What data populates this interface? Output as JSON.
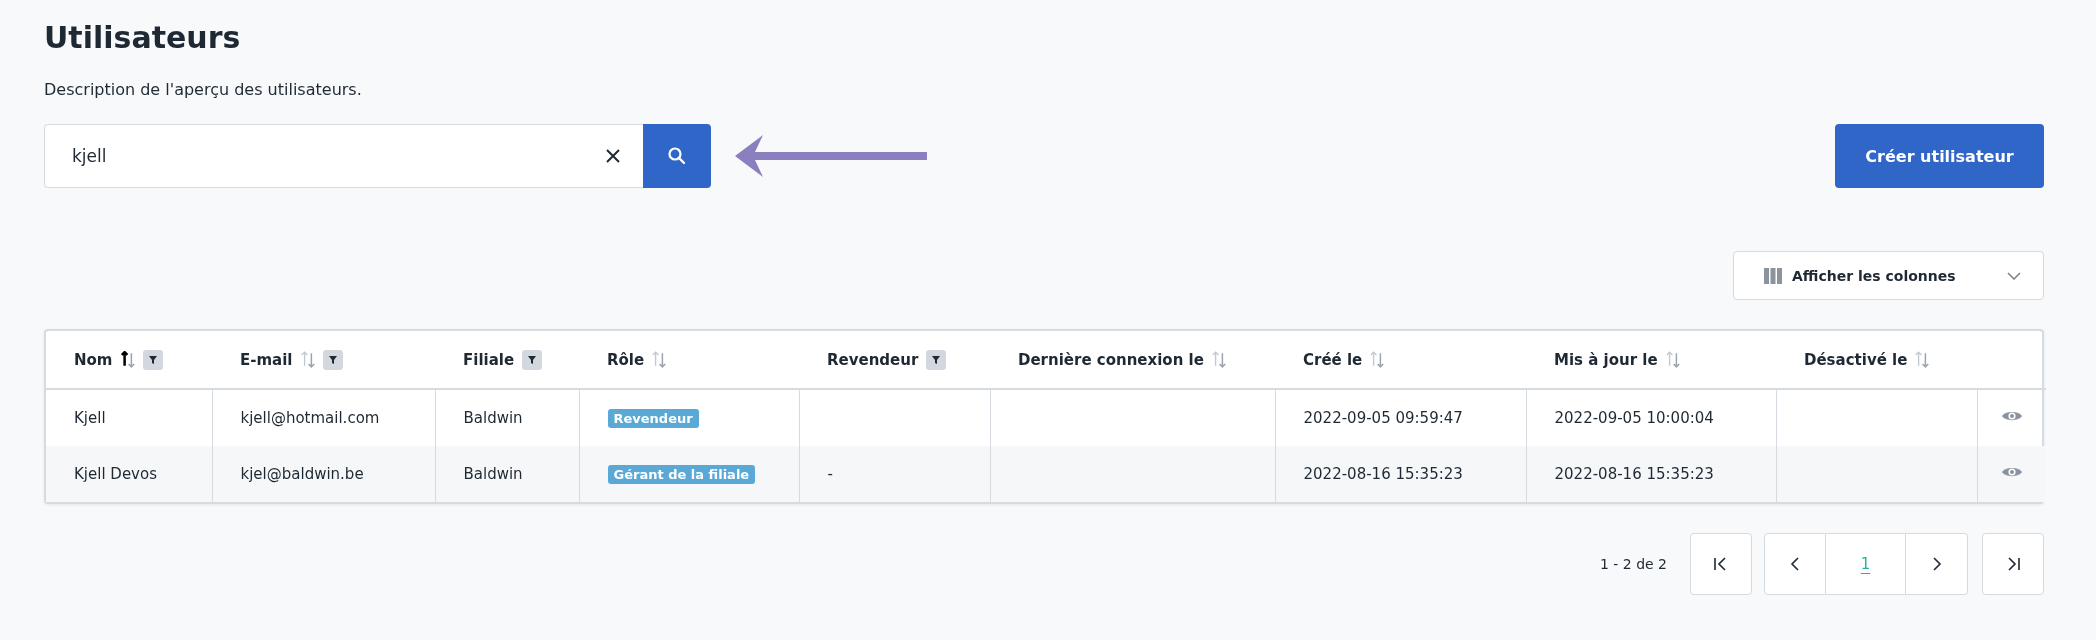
{
  "title": "Utilisateurs",
  "description": "Description de l'aperçu des utilisateurs.",
  "search": {
    "value": "kjell"
  },
  "create_button": "Créer utilisateur",
  "columns_button": "Afficher les colonnes",
  "table": {
    "columns": [
      {
        "label": "Nom",
        "sortable": true,
        "sorted": true,
        "filter": true
      },
      {
        "label": "E-mail",
        "sortable": true,
        "sorted": false,
        "filter": true
      },
      {
        "label": "Filiale",
        "sortable": false,
        "filter": true
      },
      {
        "label": "Rôle",
        "sortable": true,
        "sorted": false,
        "filter": false
      },
      {
        "label": "Revendeur",
        "sortable": false,
        "filter": true
      },
      {
        "label": "Dernière connexion le",
        "sortable": true,
        "sorted": false,
        "filter": false
      },
      {
        "label": "Créé le",
        "sortable": true,
        "sorted": false,
        "filter": false
      },
      {
        "label": "Mis à jour le",
        "sortable": true,
        "sorted": false,
        "filter": false
      },
      {
        "label": "Désactivé le",
        "sortable": true,
        "sorted": false,
        "filter": false
      }
    ],
    "rows": [
      {
        "name": "Kjell",
        "email": "kjell@hotmail.com",
        "branch": "Baldwin",
        "role": "Revendeur",
        "created": "2022-09-05 09:59:47",
        "updated": "2022-09-05 10:00:04"
      },
      {
        "name": "Kjell Devos",
        "email": "kjel@baldwin.be",
        "branch": "Baldwin",
        "role": "Gérant de la filiale",
        "reseller": "-",
        "created": "2022-08-16 15:35:23",
        "updated": "2022-08-16 15:35:23"
      }
    ]
  },
  "pagination": {
    "range": "1 - 2 de 2",
    "pages": [
      {
        "label": "1",
        "selected": true
      }
    ]
  }
}
